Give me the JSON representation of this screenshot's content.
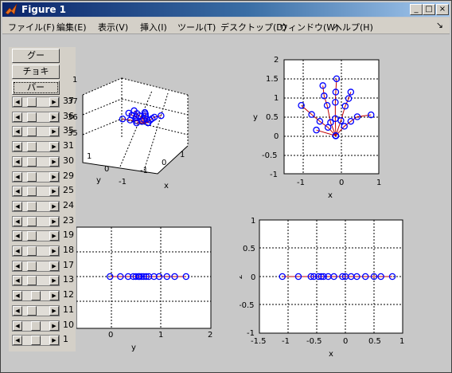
{
  "window": {
    "title": "Figure 1"
  },
  "title_buttons": [
    "_",
    "□",
    "×"
  ],
  "menus": [
    "ファイル(F)",
    "編集(E)",
    "表示(V)",
    "挿入(I)",
    "ツール(T)",
    "デスクトップ(D)",
    "ウィンドウ(W)",
    "ヘルプ(H)"
  ],
  "panel": {
    "buttons": [
      "グー",
      "チョキ",
      "パー"
    ],
    "focused_button": 2,
    "sliders": [
      {
        "value": "37",
        "level": 0.25
      },
      {
        "value": "36",
        "level": 0.25
      },
      {
        "value": "35",
        "level": 0.25
      },
      {
        "value": "31",
        "level": 0.25
      },
      {
        "value": "30",
        "level": 0.25
      },
      {
        "value": "29",
        "level": 0.25
      },
      {
        "value": "25",
        "level": 0.25
      },
      {
        "value": "24",
        "level": 0.25
      },
      {
        "value": "23",
        "level": 0.25
      },
      {
        "value": "19",
        "level": 0.25
      },
      {
        "value": "18",
        "level": 0.25
      },
      {
        "value": "17",
        "level": 0.25
      },
      {
        "value": "13",
        "level": 0.25
      },
      {
        "value": "12",
        "level": 0.5
      },
      {
        "value": "11",
        "level": 0.25
      },
      {
        "value": "10",
        "level": 0.5
      },
      {
        "value": "1",
        "level": 0.5
      }
    ]
  },
  "axes": {
    "topleft": {
      "zticks": [
        "1",
        "37",
        "36",
        "35"
      ],
      "yticks": [
        "1",
        "0",
        "-1"
      ],
      "xticks": [
        "-1",
        "0",
        "1"
      ],
      "xlabel": "x",
      "ylabel": "y"
    },
    "topright": {
      "xticks": [
        "-1",
        "0",
        "1"
      ],
      "yticks": [
        "2",
        "1.5",
        "1",
        "0.5",
        "0",
        "-0.5",
        "-1"
      ],
      "xlabel": "x",
      "ylabel": "y"
    },
    "bottomleft": {
      "xticks": [
        "0",
        "1",
        "2"
      ],
      "xlabel": "y"
    },
    "bottomright": {
      "xticks": [
        "-1.5",
        "-1",
        "-0.5",
        "0",
        "0.5",
        "1"
      ],
      "yticks": [
        "1",
        "0.5",
        "0",
        "-0.5",
        "-1"
      ],
      "xlabel": "x",
      "ylabel": "z"
    }
  },
  "chart_data": [
    {
      "type": "scatter",
      "title": "",
      "xlabel": "x",
      "ylabel": "y",
      "xlim": [
        -1.2,
        1
      ],
      "ylim": [
        -1,
        2
      ],
      "marker": "circle",
      "marker_color": "#0000ff",
      "line_color": "#c00000",
      "fingers": [
        {
          "x": [
            0,
            -0.18,
            -0.37,
            -0.56,
            -0.8
          ],
          "y": [
            0,
            0.22,
            0.38,
            0.56,
            0.8
          ]
        },
        {
          "x": [
            0,
            -0.12,
            -0.2,
            -0.27,
            -0.3
          ],
          "y": [
            0,
            0.35,
            0.8,
            1.05,
            1.32
          ]
        },
        {
          "x": [
            0,
            -0.01,
            -0.01,
            0,
            0.02
          ],
          "y": [
            0,
            0.45,
            0.88,
            1.15,
            1.5
          ]
        },
        {
          "x": [
            0,
            0.12,
            0.22,
            0.3,
            0.35
          ],
          "y": [
            0,
            0.4,
            0.78,
            0.98,
            1.15
          ]
        },
        {
          "x": [
            0,
            0.2,
            0.35,
            0.5,
            0.82
          ],
          "y": [
            0,
            0.25,
            0.38,
            0.5,
            0.55
          ]
        },
        {
          "x": [
            0,
            -0.45
          ],
          "y": [
            0,
            0.15
          ]
        }
      ]
    },
    {
      "type": "scatter",
      "xlabel": "y",
      "xlim": [
        -0.6,
        2
      ],
      "points_y": [
        0.05,
        0.25,
        0.4,
        0.5,
        0.55,
        0.6,
        0.62,
        0.66,
        0.7,
        0.75,
        0.8,
        0.9,
        1.0,
        1.15,
        1.3,
        1.52
      ]
    },
    {
      "type": "scatter",
      "xlabel": "x",
      "ylabel": "z",
      "xlim": [
        -1.5,
        1
      ],
      "ylim": [
        -1,
        1
      ],
      "points_x": [
        -1.1,
        -0.82,
        -0.6,
        -0.55,
        -0.47,
        -0.42,
        -0.38,
        -0.3,
        -0.2,
        -0.05,
        0,
        0.1,
        0.2,
        0.35,
        0.5,
        0.62,
        0.82
      ]
    }
  ]
}
